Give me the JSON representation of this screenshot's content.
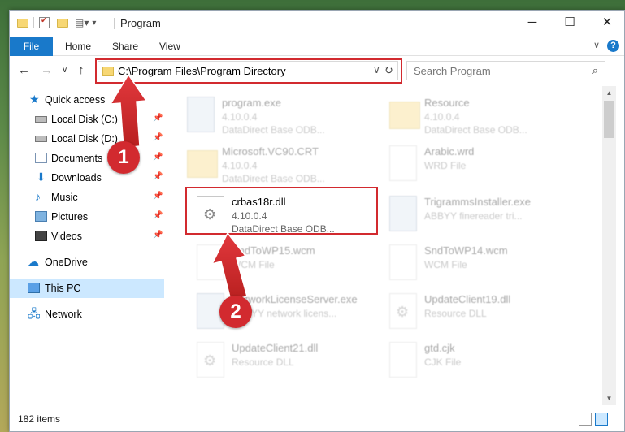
{
  "window": {
    "title": "Program"
  },
  "ribbon": {
    "tabs": [
      "File",
      "Home",
      "Share",
      "View"
    ]
  },
  "address": {
    "path": "C:\\Program Files\\Program Directory"
  },
  "search": {
    "placeholder": "Search Program"
  },
  "sidebar": {
    "items": [
      {
        "label": "Quick access",
        "icon": "star-icon"
      },
      {
        "label": "Local Disk (C:)",
        "icon": "disk-icon",
        "pinned": true
      },
      {
        "label": "Local Disk (D:)",
        "icon": "disk-icon",
        "pinned": true
      },
      {
        "label": "Documents",
        "icon": "documents-icon",
        "pinned": true
      },
      {
        "label": "Downloads",
        "icon": "download-icon",
        "pinned": true
      },
      {
        "label": "Music",
        "icon": "music-icon",
        "pinned": true
      },
      {
        "label": "Pictures",
        "icon": "pictures-icon",
        "pinned": true
      },
      {
        "label": "Videos",
        "icon": "videos-icon",
        "pinned": true
      },
      {
        "label": "OneDrive",
        "icon": "cloud-icon"
      },
      {
        "label": "This PC",
        "icon": "pc-icon",
        "selected": true
      },
      {
        "label": "Network",
        "icon": "network-icon"
      }
    ]
  },
  "files": [
    {
      "name": "program.exe",
      "version": "4.10.0.4",
      "desc": "DataDirect Base ODB...",
      "kind": "exe"
    },
    {
      "name": "Resource",
      "version": "4.10.0.4",
      "desc": "DataDirect Base ODB...",
      "kind": "folder"
    },
    {
      "name": "Microsoft.VC90.CRT",
      "version": "4.10.0.4",
      "desc": "DataDirect Base ODB...",
      "kind": "folder"
    },
    {
      "name": "Arabic.wrd",
      "version": "WRD File",
      "desc": "",
      "kind": "file"
    },
    {
      "name": "crbas18r.dll",
      "version": "4.10.0.4",
      "desc": "DataDirect Base ODB...",
      "kind": "dll"
    },
    {
      "name": "TrigrammsInstaller.exe",
      "version": "ABBYY finereader tri...",
      "desc": "",
      "kind": "exe"
    },
    {
      "name": "SndToWP15.wcm",
      "version": "WCM File",
      "desc": "",
      "kind": "file"
    },
    {
      "name": "SndToWP14.wcm",
      "version": "WCM File",
      "desc": "",
      "kind": "file"
    },
    {
      "name": "NetworkLicenseServer.exe",
      "version": "ABBYY network licens...",
      "desc": "",
      "kind": "exe"
    },
    {
      "name": "UpdateClient19.dll",
      "version": "Resource DLL",
      "desc": "",
      "kind": "dll"
    },
    {
      "name": "UpdateClient21.dll",
      "version": "Resource DLL",
      "desc": "",
      "kind": "dll"
    },
    {
      "name": "gtd.cjk",
      "version": "CJK File",
      "desc": "",
      "kind": "file"
    }
  ],
  "status": {
    "item_count": "182 items"
  },
  "callouts": [
    "1",
    "2"
  ],
  "colors": {
    "accent": "#1979ca",
    "highlight": "#d22a2f"
  }
}
